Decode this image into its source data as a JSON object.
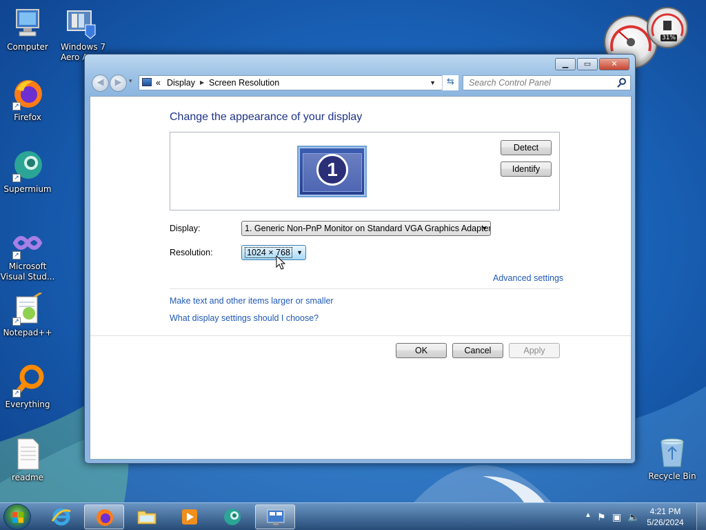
{
  "desktop": {
    "icons": [
      {
        "label": "Computer",
        "icon": "computer-icon"
      },
      {
        "label": "Windows 7 Aero A...",
        "icon": "windows-aero-icon"
      },
      {
        "label": "Firefox",
        "icon": "firefox-icon"
      },
      {
        "label": "Supermium",
        "icon": "supermium-icon"
      },
      {
        "label": "Microsoft Visual Stud...",
        "icon": "visual-studio-icon"
      },
      {
        "label": "Notepad++",
        "icon": "notepadpp-icon"
      },
      {
        "label": "Everything",
        "icon": "everything-icon"
      },
      {
        "label": "readme",
        "icon": "text-file-icon"
      },
      {
        "label": "Recycle Bin",
        "icon": "recycle-bin-icon"
      }
    ],
    "gadgets": {
      "cpu_meter_percent": "31%"
    }
  },
  "window": {
    "address": {
      "prefix": "«",
      "crumbs": [
        "Display",
        "Screen Resolution"
      ]
    },
    "search": {
      "placeholder": "Search Control Panel"
    },
    "content": {
      "heading": "Change the appearance of your display",
      "monitor_number": "1",
      "detect_label": "Detect",
      "identify_label": "Identify",
      "display_label": "Display:",
      "display_value": "1. Generic Non-PnP Monitor on Standard VGA Graphics Adapter",
      "resolution_label": "Resolution:",
      "resolution_value": "1024 × 768",
      "advanced_link": "Advanced settings",
      "text_size_link": "Make text and other items larger or smaller",
      "help_link": "What display settings should I choose?",
      "ok_label": "OK",
      "cancel_label": "Cancel",
      "apply_label": "Apply"
    }
  },
  "taskbar": {
    "pinned": [
      {
        "name": "internet-explorer",
        "icon": "ie-icon"
      },
      {
        "name": "firefox",
        "icon": "firefox-icon"
      },
      {
        "name": "explorer",
        "icon": "folder-icon"
      },
      {
        "name": "media-player",
        "icon": "media-player-icon"
      },
      {
        "name": "supermium",
        "icon": "supermium-icon"
      },
      {
        "name": "control-panel",
        "icon": "control-panel-icon"
      }
    ],
    "time": "4:21 PM",
    "date": "5/26/2024"
  },
  "colors": {
    "link": "#1f59b5",
    "heading": "#1e3287"
  }
}
